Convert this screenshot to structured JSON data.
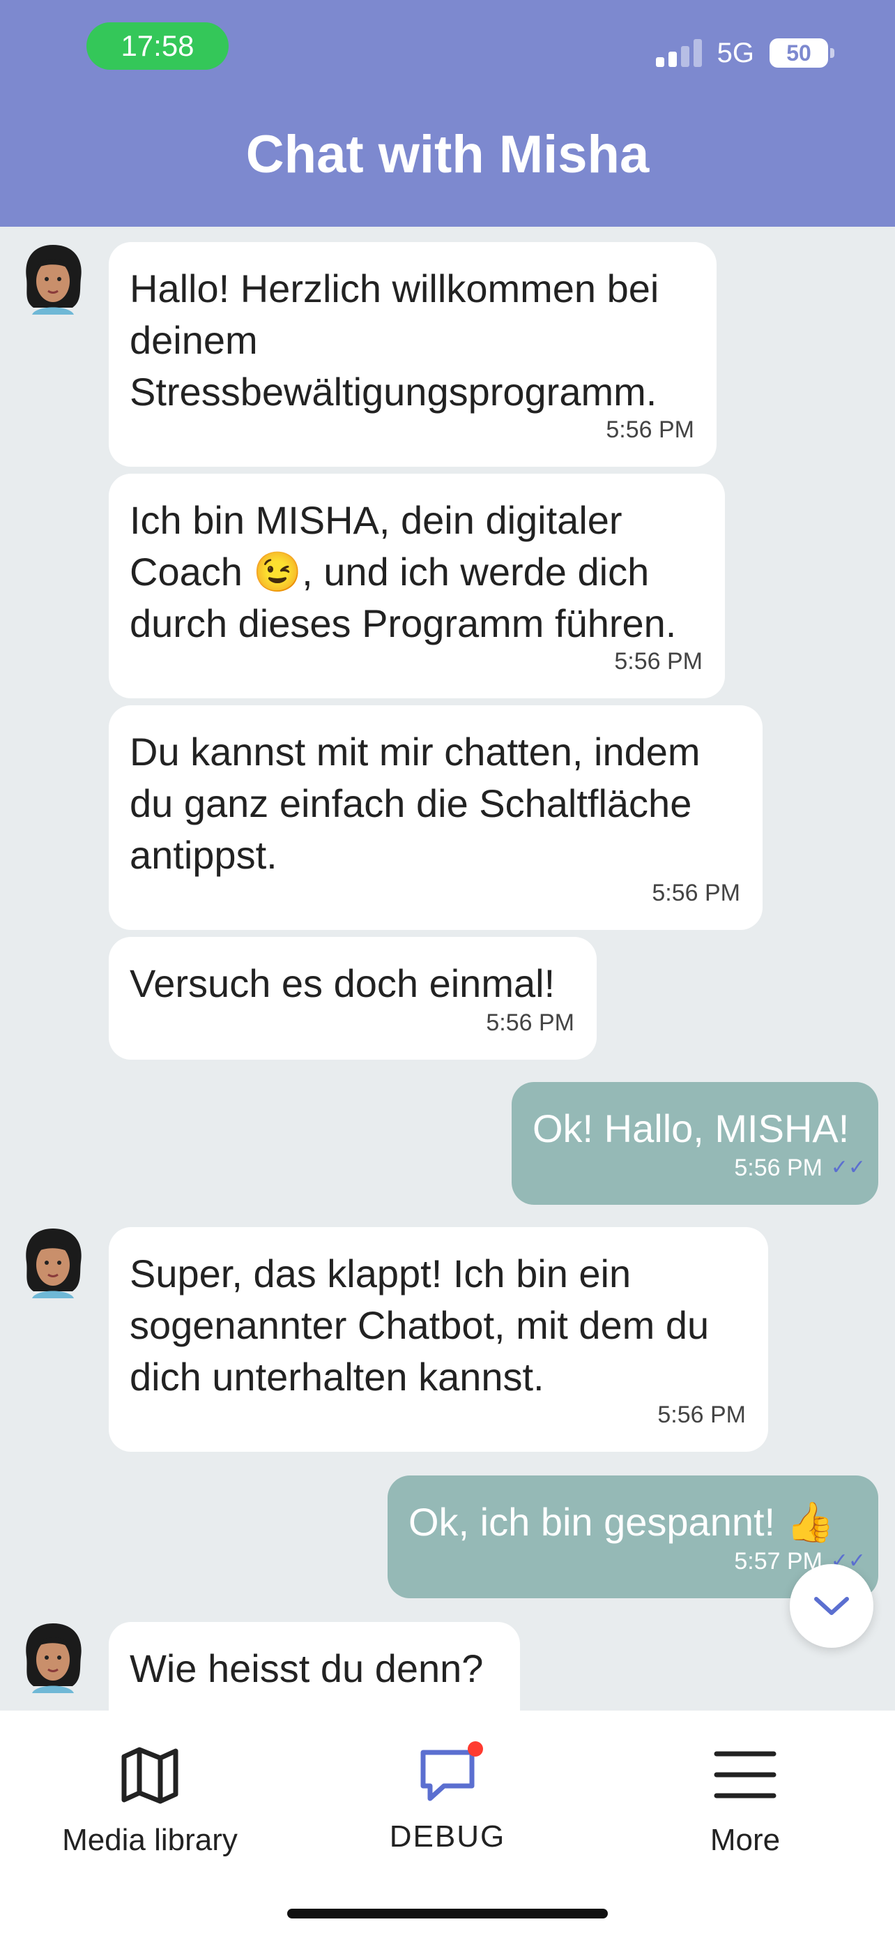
{
  "status_bar": {
    "time": "17:58",
    "network": "5G",
    "battery": "50"
  },
  "header": {
    "title": "Chat with Misha"
  },
  "messages": [
    {
      "direction": "in",
      "text": "Hallo! Herzlich willkommen bei deinem Stressbewältigungsprogramm.",
      "time": "5:56 PM"
    },
    {
      "direction": "in",
      "text": "Ich bin MISHA, dein digitaler Coach 😉, und ich werde dich durch dieses Programm führen.",
      "time": "5:56 PM"
    },
    {
      "direction": "in",
      "text": "Du kannst mit mir chatten, indem du ganz einfach die Schaltfläche antippst.",
      "time": "5:56 PM"
    },
    {
      "direction": "in",
      "text": "Versuch es doch einmal!",
      "time": "5:56 PM"
    },
    {
      "direction": "out",
      "text": "Ok! Hallo, MISHA!",
      "time": "5:56 PM"
    },
    {
      "direction": "in",
      "text": "Super, das klappt! Ich bin ein sogenannter Chatbot, mit dem du dich unterhalten kannst.",
      "time": "5:56 PM"
    },
    {
      "direction": "out",
      "text": "Ok, ich bin gespannt! 👍",
      "time": "5:57 PM"
    },
    {
      "direction": "in",
      "text": "Wie heisst du denn?",
      "time": ""
    }
  ],
  "tabbar": {
    "media_label": "Media library",
    "chat_label": "DEBUG",
    "more_label": "More"
  },
  "colors": {
    "header": "#7d89cf",
    "outgoing_bubble": "#95b9b6",
    "badge": "#ff3b30"
  }
}
